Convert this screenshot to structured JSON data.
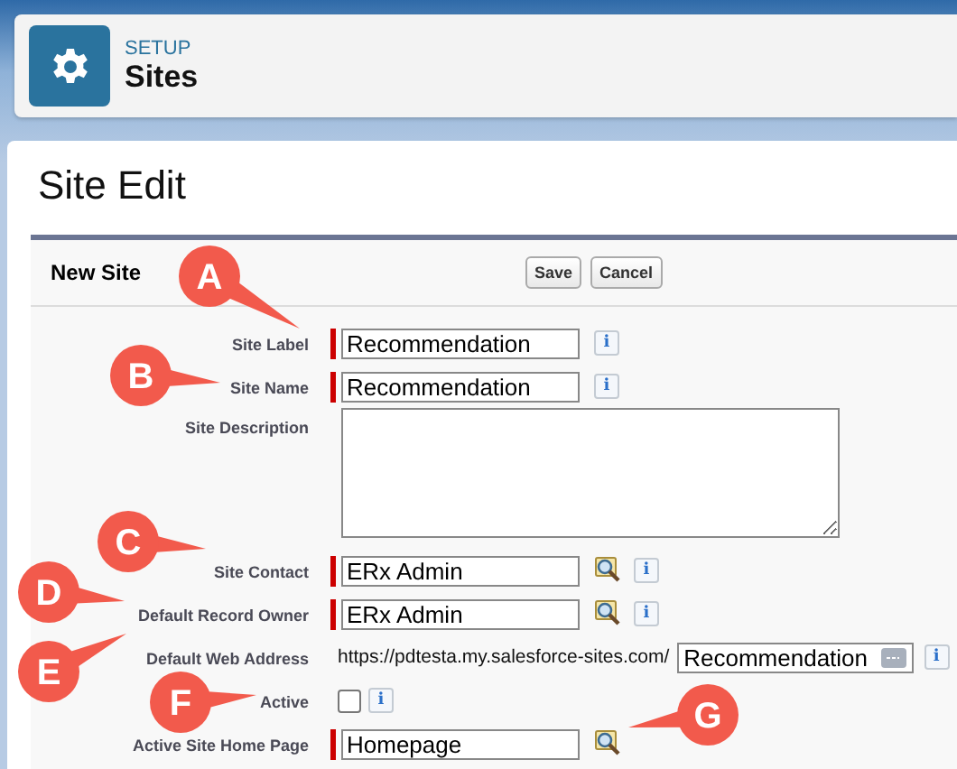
{
  "header": {
    "eyebrow": "SETUP",
    "title": "Sites"
  },
  "page_title": "Site Edit",
  "panel": {
    "title": "New Site",
    "buttons": [
      "Save",
      "Cancel"
    ]
  },
  "rows": [
    {
      "kind": "text",
      "label": "Site Label",
      "required": true,
      "value": "Recommendation",
      "info": "i"
    },
    {
      "kind": "text",
      "label": "Site Name",
      "required": true,
      "value": "Recommendation",
      "info": "i"
    },
    {
      "kind": "textarea",
      "label": "Site Description",
      "value": ""
    },
    {
      "kind": "lookup",
      "label": "Site Contact",
      "required": true,
      "value": "ERx Admin",
      "info": "i"
    },
    {
      "kind": "lookup",
      "label": "Default Record Owner",
      "required": true,
      "value": "ERx Admin",
      "info": "i"
    },
    {
      "kind": "url",
      "label": "Default Web Address",
      "prefix": "https://pdtesta.my.salesforce-sites.com/",
      "value": "Recommendation",
      "info": "i"
    },
    {
      "kind": "checkbox",
      "label": "Active",
      "checked": false,
      "info": "i"
    },
    {
      "kind": "lookup",
      "label": "Active Site Home Page",
      "required": true,
      "value": "Homepage"
    }
  ],
  "callouts": [
    "A",
    "B",
    "C",
    "D",
    "E",
    "F",
    "G"
  ]
}
